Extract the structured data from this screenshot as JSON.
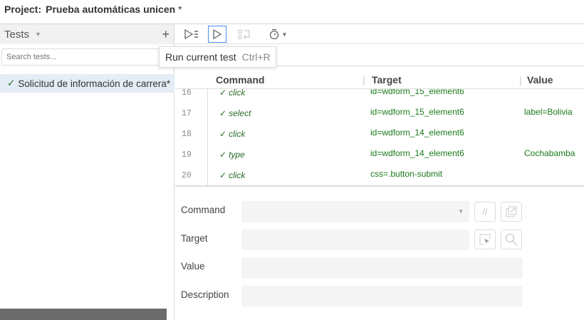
{
  "project": {
    "label": "Project:",
    "name": "Prueba automáticas unicen",
    "dirty": "*"
  },
  "tests_panel": {
    "title": "Tests",
    "search_placeholder": "Search tests...",
    "items": [
      {
        "status": "✓",
        "name": "Solicitud de información de carrera*"
      }
    ]
  },
  "toolbar": {
    "tooltip": {
      "label": "Run current test",
      "shortcut": "Ctrl+R"
    }
  },
  "table": {
    "headers": {
      "command": "Command",
      "target": "Target",
      "value": "Value"
    },
    "rows": [
      {
        "n": "16",
        "command": "click",
        "target": "id=wdform_15_element6",
        "value": ""
      },
      {
        "n": "17",
        "command": "select",
        "target": "id=wdform_15_element6",
        "value": "label=Bolivia"
      },
      {
        "n": "18",
        "command": "click",
        "target": "id=wdform_14_element6",
        "value": ""
      },
      {
        "n": "19",
        "command": "type",
        "target": "id=wdform_14_element6",
        "value": "Cochabamba"
      },
      {
        "n": "20",
        "command": "click",
        "target": "css=.button-submit",
        "value": ""
      }
    ]
  },
  "editor": {
    "command_label": "Command",
    "target_label": "Target",
    "value_label": "Value",
    "description_label": "Description",
    "comment_btn": "//"
  }
}
